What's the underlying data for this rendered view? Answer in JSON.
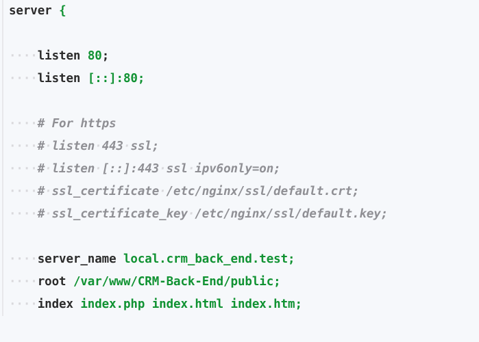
{
  "ws4": "····",
  "ws1": "·",
  "t": {
    "server": "server",
    "lb": "{",
    "listen": "listen",
    "p80": "80",
    "semi": ";",
    "ipv6_80": "[::]:80;",
    "c1": "# For https",
    "c2": "# listen 443 ssl;",
    "c3": "# listen [::]:443 ssl ipv6only=on;",
    "c4": "# ssl_certificate /etc/nginx/ssl/default.crt;",
    "c5": "# ssl_certificate_key /etc/nginx/ssl/default.key;",
    "server_name": "server_name",
    "server_name_val": "local.crm_back_end.test;",
    "root": "root",
    "root_val": "/var/www/CRM-Back-End/public;",
    "index": "index",
    "index_val": "index.php index.html index.htm;"
  }
}
